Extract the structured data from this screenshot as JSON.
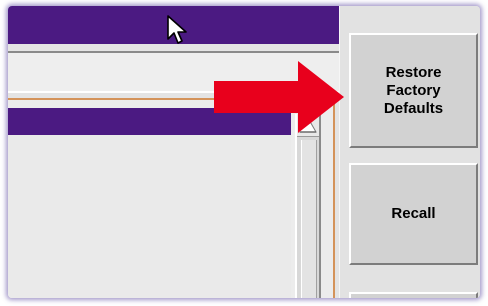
{
  "buttons": {
    "restore_label": "Restore\nFactory\nDefaults",
    "recall_label": "Recall"
  },
  "icons": {
    "cursor": "mouse-pointer-icon",
    "annotation_arrow": "red-arrow-icon",
    "scroll_up": "scroll-up-arrow-icon"
  },
  "colors": {
    "title_bar": "#4b1a82",
    "panel_border": "#d4935a",
    "annotation_arrow": "#e8001c",
    "button_face": "#d2d2d2"
  }
}
